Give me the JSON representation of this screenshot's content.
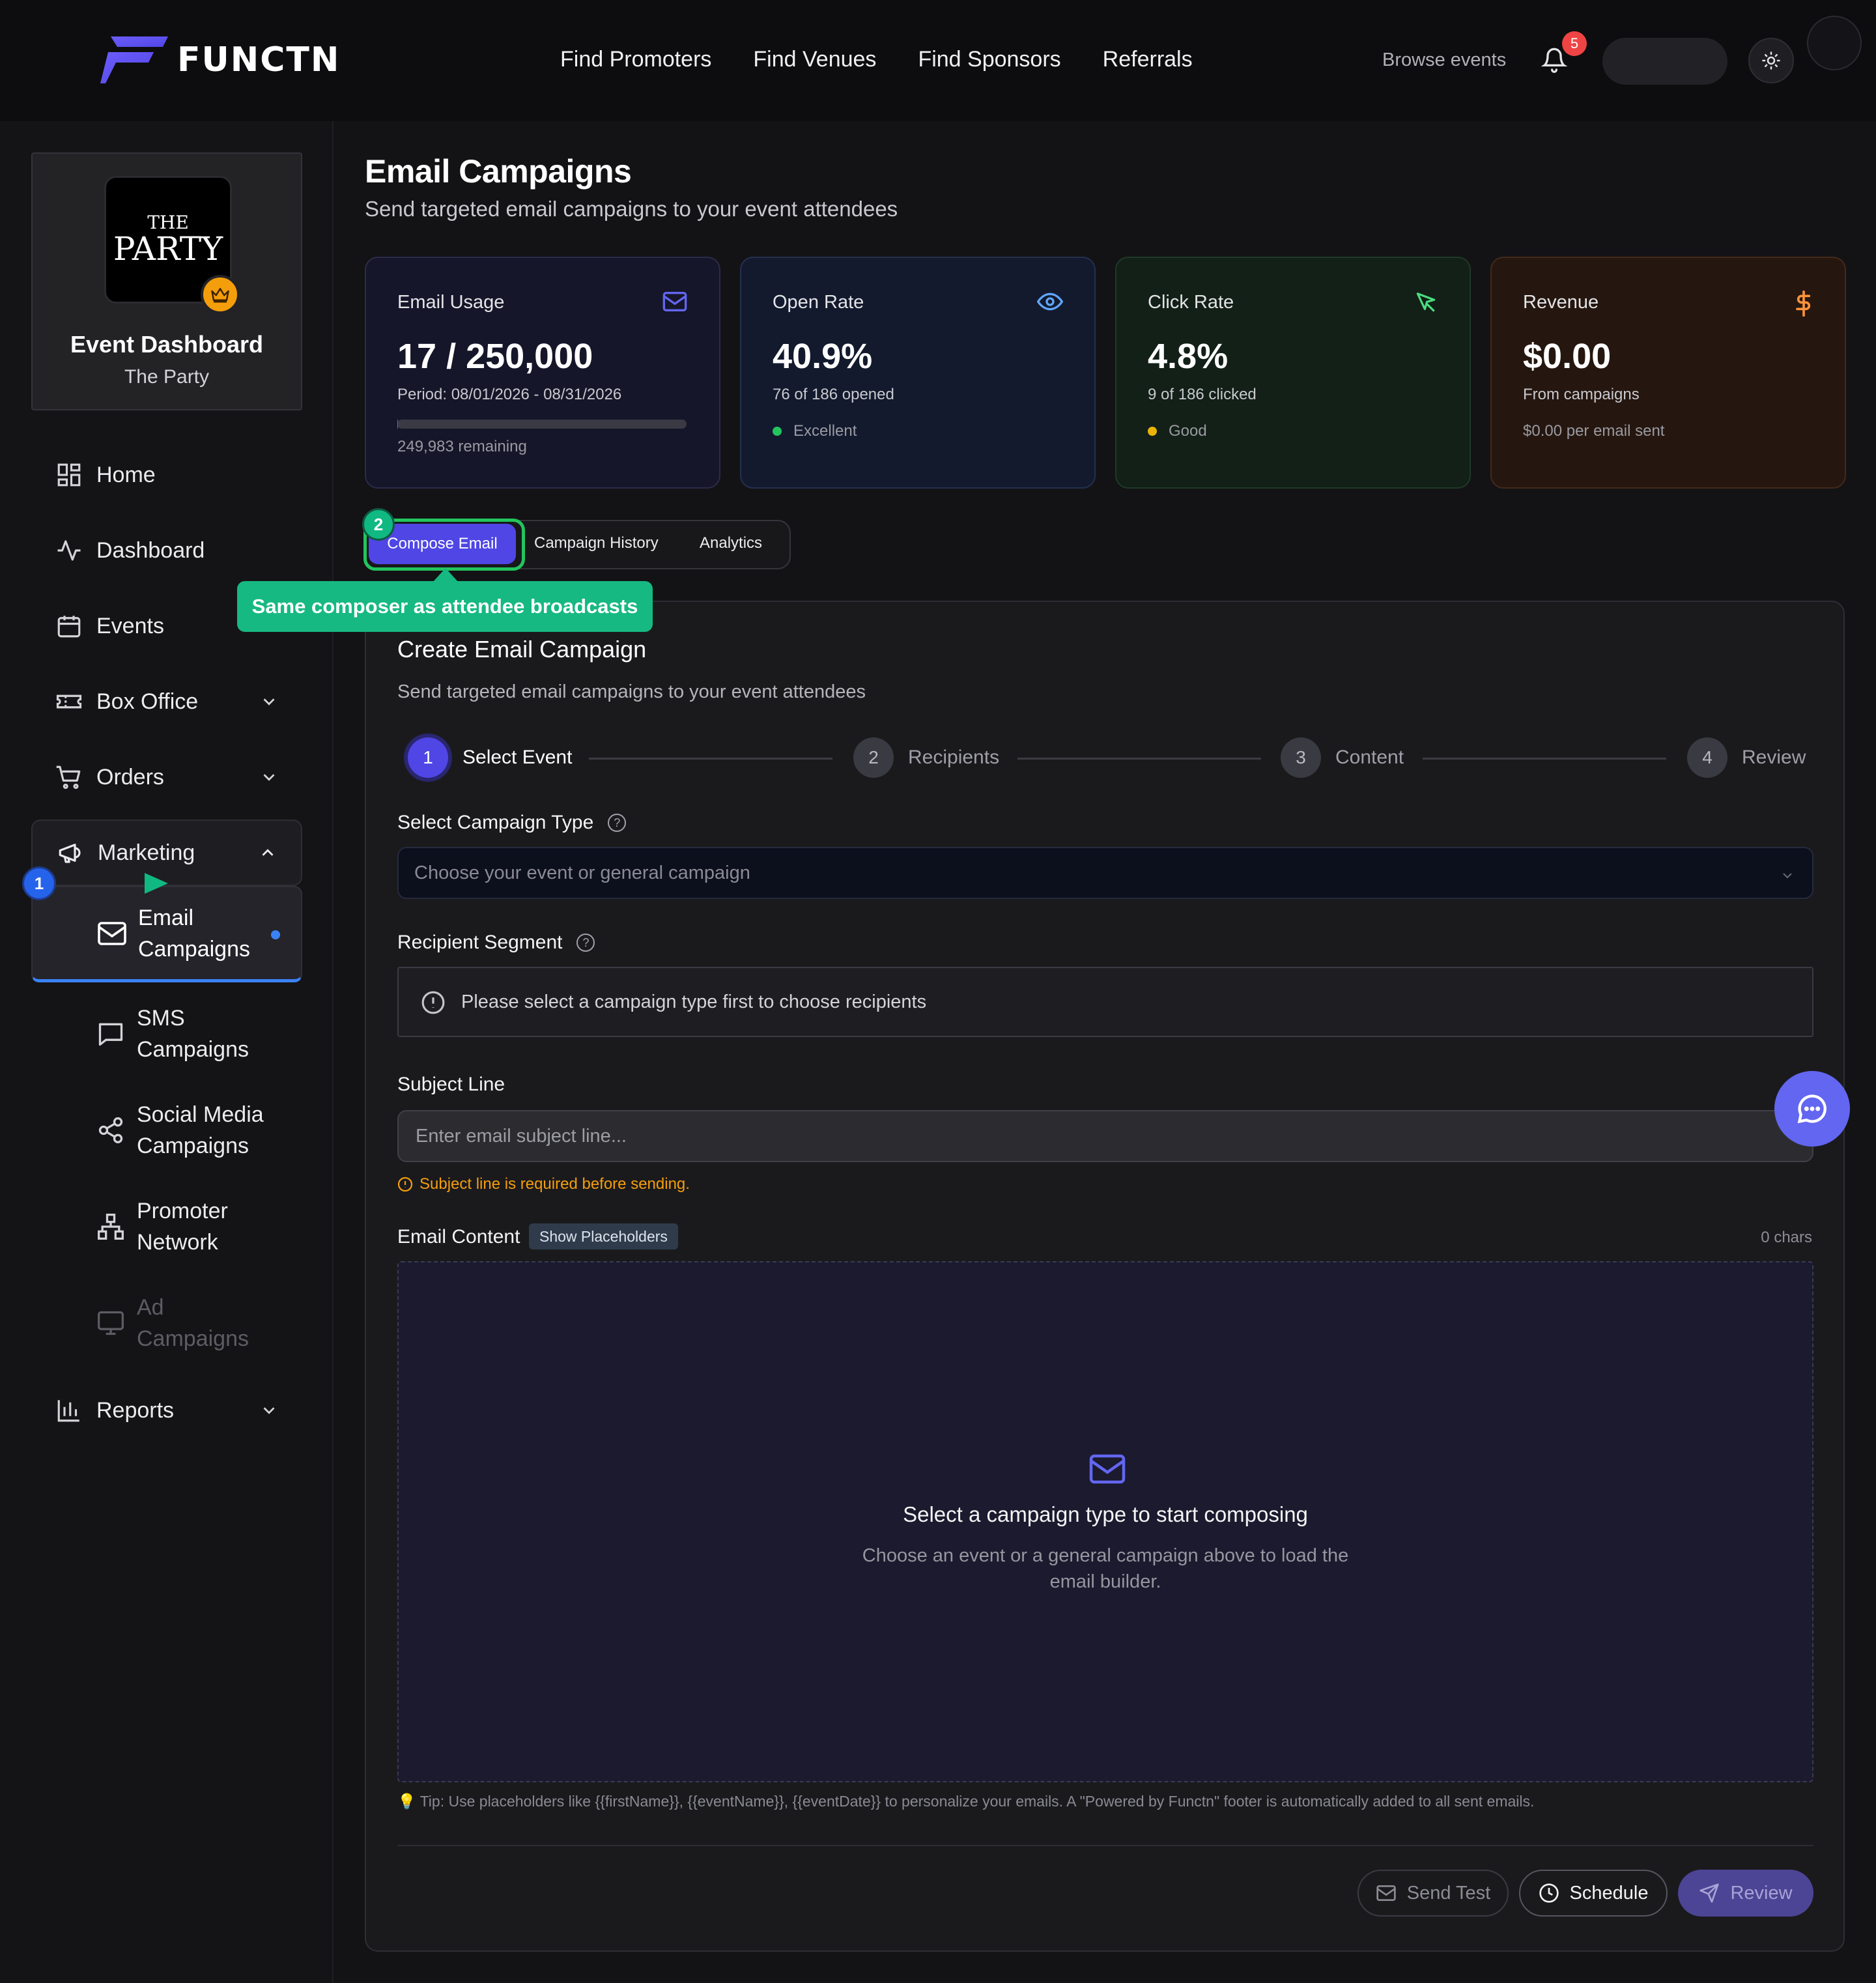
{
  "brand": {
    "name": "FUNCTN",
    "accent": "#6d5dfc"
  },
  "nav": {
    "items": [
      "Find Promoters",
      "Find Venues",
      "Find Sponsors",
      "Referrals"
    ],
    "browse": "Browse events",
    "notification_count": "5"
  },
  "sidebar": {
    "event": {
      "logo_line1": "THE",
      "logo_line2": "PARTY",
      "title": "Event Dashboard",
      "subtitle": "The Party"
    },
    "items": [
      {
        "label": "Home",
        "icon": "grid-icon"
      },
      {
        "label": "Dashboard",
        "icon": "activity-icon"
      },
      {
        "label": "Events",
        "icon": "calendar-icon"
      },
      {
        "label": "Box Office",
        "icon": "ticket-icon"
      },
      {
        "label": "Orders",
        "icon": "cart-icon"
      },
      {
        "label": "Marketing",
        "icon": "megaphone-icon"
      }
    ],
    "marketing_sub": [
      {
        "line1": "Email",
        "line2": "Campaigns",
        "icon": "mail-icon"
      },
      {
        "line1": "SMS",
        "line2": "Campaigns",
        "icon": "message-icon"
      },
      {
        "line1": "Social Media",
        "line2": "Campaigns",
        "icon": "share-icon"
      },
      {
        "line1": "Promoter",
        "line2": "Network",
        "icon": "network-icon"
      },
      {
        "line1": "Ad",
        "line2": "Campaigns",
        "icon": "monitor-icon"
      }
    ],
    "reports": "Reports"
  },
  "page": {
    "title": "Email Campaigns",
    "subtitle": "Send targeted email campaigns to your event attendees"
  },
  "stats": [
    {
      "label": "Email Usage",
      "value": "17 / 250,000",
      "line1": "Period: 08/01/2026 - 08/31/2026",
      "line2": "249,983 remaining",
      "usage_fraction": 7e-05,
      "color": "#6366f1"
    },
    {
      "label": "Open Rate",
      "value": "40.9%",
      "line1": "76 of 186 opened",
      "line2": "Excellent",
      "color": "#60a5fa"
    },
    {
      "label": "Click Rate",
      "value": "4.8%",
      "line1": "9 of 186 clicked",
      "line2": "Good",
      "color": "#4ade80"
    },
    {
      "label": "Revenue",
      "value": "$0.00",
      "line1": "From campaigns",
      "line2": "$0.00 per email sent",
      "color": "#fb923c"
    }
  ],
  "tabs": {
    "compose": "Compose Email",
    "history": "Campaign History",
    "analytics": "Analytics"
  },
  "tour": {
    "badge1": "1",
    "badge2": "2",
    "tooltip": "Same composer as attendee broadcasts"
  },
  "composer": {
    "title": "Create Email Campaign",
    "subtitle": "Send targeted email campaigns to your event attendees",
    "steps": [
      {
        "num": "1",
        "label": "Select Event"
      },
      {
        "num": "2",
        "label": "Recipients"
      },
      {
        "num": "3",
        "label": "Content"
      },
      {
        "num": "4",
        "label": "Review"
      }
    ],
    "campaign_type_label": "Select Campaign Type",
    "campaign_type_placeholder": "Choose your event or general campaign",
    "segment_label": "Recipient Segment",
    "segment_notice": "Please select a campaign type first to choose recipients",
    "subject_label": "Subject Line",
    "subject_placeholder": "Enter email subject line...",
    "subject_warning": "Subject line is required before sending.",
    "content_label": "Email Content",
    "placeholders_button": "Show Placeholders",
    "chars": "0 chars",
    "empty_title": "Select a campaign type to start composing",
    "empty_subtitle": "Choose an event or a general campaign above to load the email builder.",
    "tip": "💡 Tip: Use placeholders like {{firstName}}, {{eventName}}, {{eventDate}} to personalize your emails. A \"Powered by Functn\" footer is automatically added to all sent emails.",
    "buttons": {
      "send_test": "Send Test",
      "schedule": "Schedule",
      "review": "Review"
    }
  }
}
